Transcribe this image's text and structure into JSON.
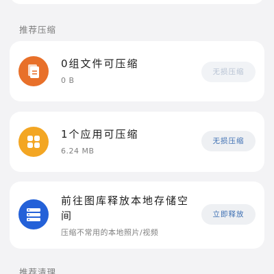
{
  "sections": {
    "recommend_compress": "推荐压缩",
    "recommend_clean": "推荐清理"
  },
  "cards": [
    {
      "title": "0组文件可压缩",
      "subtitle": "0 B",
      "button": "无损压缩",
      "button_enabled": false,
      "icon": "file-copy-icon",
      "icon_color": "#e8702a"
    },
    {
      "title": "1个应用可压缩",
      "subtitle": "6.24 MB",
      "button": "无损压缩",
      "button_enabled": true,
      "icon": "apps-grid-icon",
      "icon_color": "#f3a623"
    },
    {
      "title": "前往图库释放本地存储空间",
      "subtitle": "压缩不常用的本地照片/视频",
      "button": "立即释放",
      "button_enabled": true,
      "icon": "storage-icon",
      "icon_color": "#2461d8"
    }
  ]
}
